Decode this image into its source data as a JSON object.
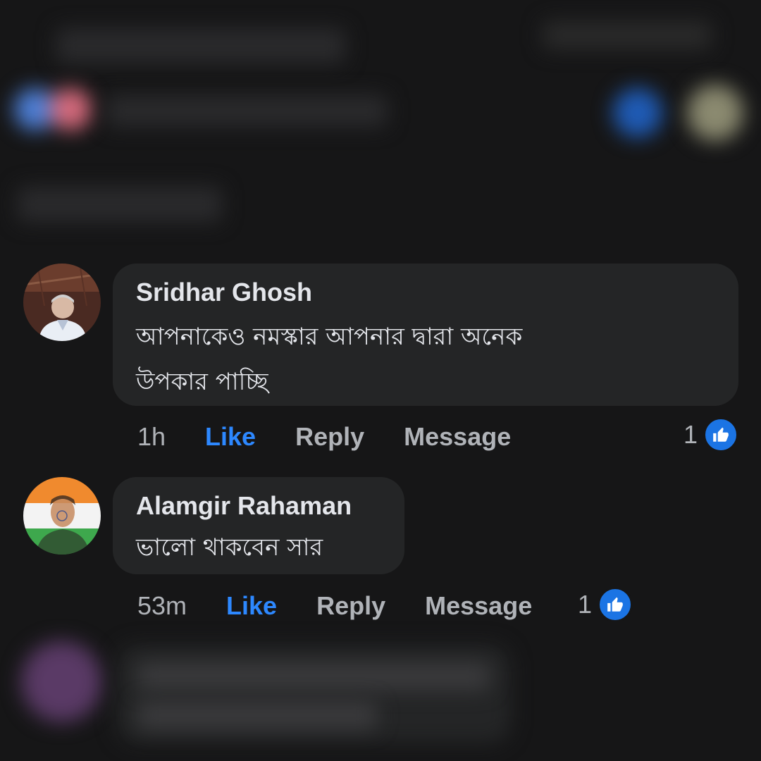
{
  "comments": [
    {
      "author": "Sridhar Ghosh",
      "text_line1": "আপনাকেও  নমস্কার  আপনার দ্বারা অনেক",
      "text_line2": "উপকার  পাচ্ছি",
      "time": "1h",
      "like_label": "Like",
      "reply_label": "Reply",
      "message_label": "Message",
      "reaction_count": "1"
    },
    {
      "author": "Alamgir Rahaman",
      "text_line1": "ভালো থাকবেন সার",
      "time": "53m",
      "like_label": "Like",
      "reply_label": "Reply",
      "message_label": "Message",
      "reaction_count": "1"
    }
  ],
  "colors": {
    "background": "#161617",
    "bubble": "#242526",
    "like_blue": "#2d88ff",
    "muted": "#b0b3b8"
  },
  "icons": {
    "reaction": "thumbs-up-icon",
    "avatar1": "avatar",
    "avatar2": "avatar"
  }
}
